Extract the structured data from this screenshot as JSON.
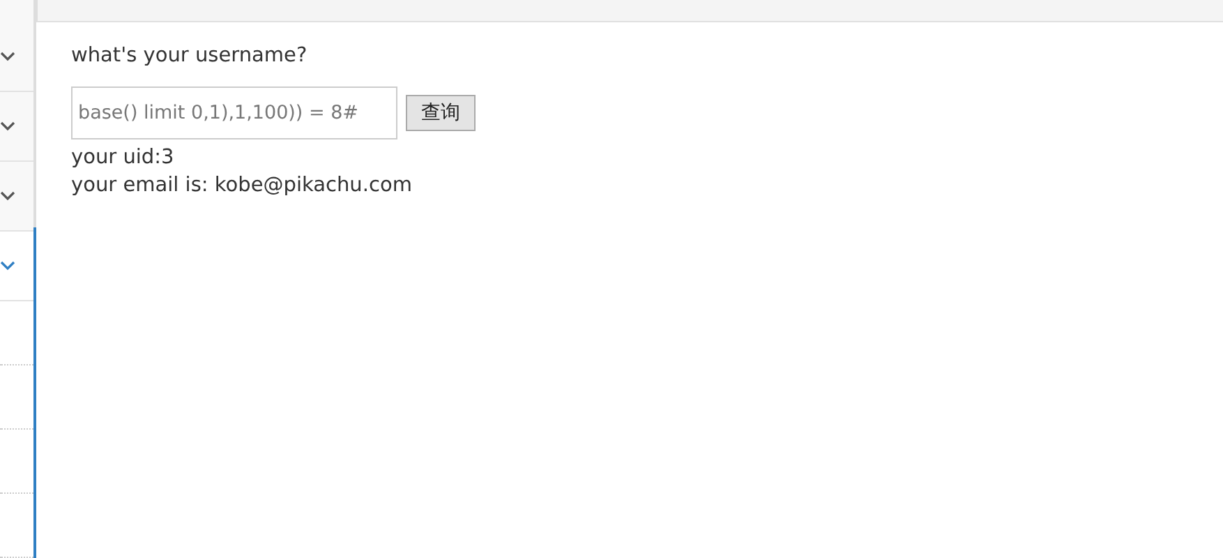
{
  "sidebar": {
    "items": [
      {
        "expanded": false
      },
      {
        "expanded": false
      },
      {
        "expanded": false
      },
      {
        "expanded": true
      }
    ]
  },
  "form": {
    "label": "what's your username?",
    "value": "base() limit 0,1),1,100)) = 8#",
    "button": "查询"
  },
  "results": [
    "your uid:3",
    "your email is: kobe@pikachu.com"
  ]
}
